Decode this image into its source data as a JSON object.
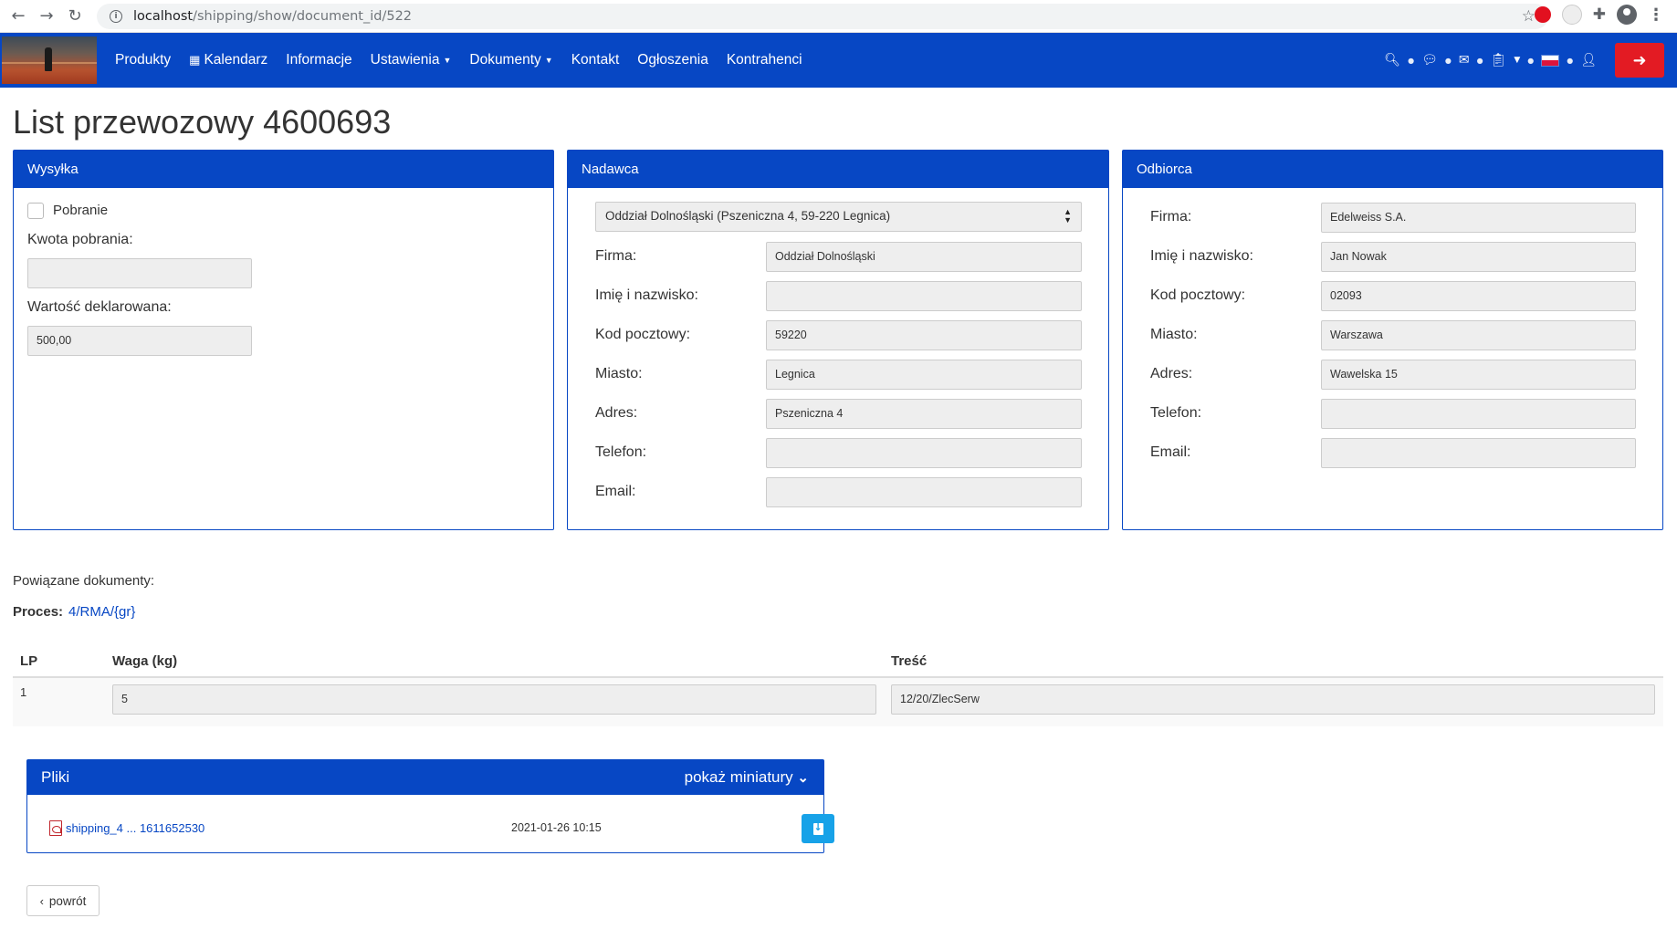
{
  "browser": {
    "url_host": "localhost",
    "url_path": "/shipping/show/document_id/522"
  },
  "navbar": {
    "items": [
      {
        "label": "Produkty"
      },
      {
        "label": "Kalendarz"
      },
      {
        "label": "Informacje"
      },
      {
        "label": "Ustawienia"
      },
      {
        "label": "Dokumenty"
      },
      {
        "label": "Kontakt"
      },
      {
        "label": "Ogłoszenia"
      },
      {
        "label": "Kontrahenci"
      }
    ]
  },
  "page": {
    "title": "List przewozowy 4600693"
  },
  "wysylka": {
    "title": "Wysyłka",
    "pobranie_label": "Pobranie",
    "kwota_label": "Kwota pobrania:",
    "kwota_value": "",
    "wartosc_label": "Wartość deklarowana:",
    "wartosc_value": "500,00"
  },
  "nadawca": {
    "title": "Nadawca",
    "select_value": "Oddział Dolnośląski (Pszeniczna 4, 59-220 Legnica)",
    "fields": [
      {
        "label": "Firma:",
        "value": "Oddział Dolnośląski"
      },
      {
        "label": "Imię i nazwisko:",
        "value": ""
      },
      {
        "label": "Kod pocztowy:",
        "value": "59220"
      },
      {
        "label": "Miasto:",
        "value": "Legnica"
      },
      {
        "label": "Adres:",
        "value": "Pszeniczna 4"
      },
      {
        "label": "Telefon:",
        "value": ""
      },
      {
        "label": "Email:",
        "value": ""
      }
    ]
  },
  "odbiorca": {
    "title": "Odbiorca",
    "fields": [
      {
        "label": "Firma:",
        "value": "Edelweiss S.A."
      },
      {
        "label": "Imię i nazwisko:",
        "value": "Jan Nowak"
      },
      {
        "label": "Kod pocztowy:",
        "value": "02093"
      },
      {
        "label": "Miasto:",
        "value": "Warszawa"
      },
      {
        "label": "Adres:",
        "value": "Wawelska 15"
      },
      {
        "label": "Telefon:",
        "value": ""
      },
      {
        "label": "Email:",
        "value": ""
      }
    ]
  },
  "related": {
    "label": "Powiązane dokumenty:",
    "proces_label": "Proces:",
    "proces_link": "4/RMA/{gr}"
  },
  "items": {
    "headers": {
      "lp": "LP",
      "waga": "Waga (kg)",
      "tresc": "Treść"
    },
    "rows": [
      {
        "lp": "1",
        "waga": "5",
        "tresc": "12/20/ZlecSerw"
      }
    ]
  },
  "files": {
    "title": "Pliki",
    "toggle_label": "pokaż miniatury",
    "list": [
      {
        "name": "shipping_4 ... 1611652530",
        "date": "2021-01-26 10:15"
      }
    ]
  },
  "back_label": "powrót"
}
